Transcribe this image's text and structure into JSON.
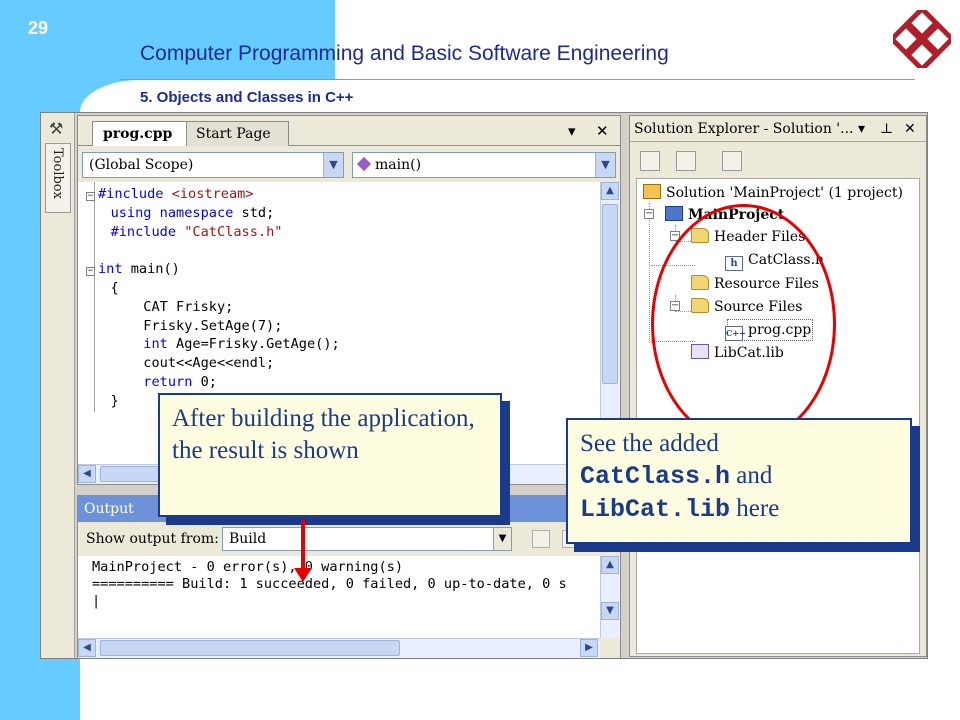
{
  "slide": {
    "page_number": "29",
    "title": "Computer Programming and Basic Software Engineering",
    "subtitle": "5. Objects and Classes in C++"
  },
  "ide": {
    "toolbox_label": "Toolbox",
    "editor": {
      "tabs": [
        {
          "label": "prog.cpp",
          "active": true
        },
        {
          "label": "Start Page",
          "active": false
        }
      ],
      "pin_glyph": "▾",
      "close_glyph": "✕",
      "scope_combo": "(Global Scope)",
      "member_combo": "main()",
      "code": [
        "#include <iostream>",
        "using namespace std;",
        "#include \"CatClass.h\"",
        "",
        "int main()",
        "{",
        "    CAT Frisky;",
        "    Frisky.SetAge(7);",
        "    int Age=Frisky.GetAge();",
        "    cout<<Age<<endl;",
        "    return 0;",
        "}"
      ]
    },
    "output": {
      "title": "Output",
      "show_from_label": "Show output from:",
      "show_from_value": "Build",
      "lines": [
        "MainProject - 0 error(s), 0 warning(s)",
        "========== Build: 1 succeeded, 0 failed, 0 up-to-date, 0 s",
        "|"
      ]
    },
    "solution_explorer": {
      "title": "Solution Explorer - Solution '...",
      "pin_glyph": "⊥",
      "close_glyph": "✕",
      "tree": {
        "solution": "Solution 'MainProject' (1 project)",
        "project": "MainProject",
        "header_files": "Header Files",
        "catclass_h": "CatClass.h",
        "resource_files": "Resource Files",
        "source_files": "Source Files",
        "prog_cpp": "prog.cpp",
        "libcat": "LibCat.lib"
      }
    }
  },
  "callouts": {
    "build": "After building the application, the result is shown",
    "added_prefix": "See the added",
    "added_file1": "CatClass.h",
    "added_and": " and",
    "added_file2": "LibCat.lib",
    "added_suffix": " here"
  },
  "colors": {
    "band": "#66ccff",
    "title": "#1a2a99",
    "callout_border": "#1a3a8c",
    "callout_fill": "#fffde0",
    "annotation_red": "#e60000",
    "output_titlebar": "#6d92d8"
  }
}
